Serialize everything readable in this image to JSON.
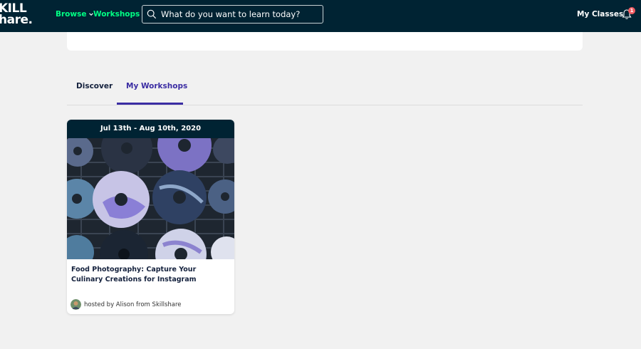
{
  "header": {
    "logo_line1": "KILL",
    "logo_line2": "hare.",
    "browse_label": "Browse",
    "workshops_label": "Workshops",
    "search_placeholder": "What do you want to learn today?",
    "my_classes_label": "My Classes",
    "notification_count": "1"
  },
  "tabs": [
    {
      "label": "Discover",
      "active": false
    },
    {
      "label": "My Workshops",
      "active": true
    }
  ],
  "card": {
    "date_range": "Jul 13th - Aug 10th, 2020",
    "title": "Food Photography: Capture Your Culinary Creations for Instagram",
    "host": "hosted by Alison from Skillshare"
  },
  "colors": {
    "nav_bg": "#002333",
    "accent_green": "#00ff84",
    "active_tab": "#3b2da3",
    "badge": "#f25c63"
  }
}
